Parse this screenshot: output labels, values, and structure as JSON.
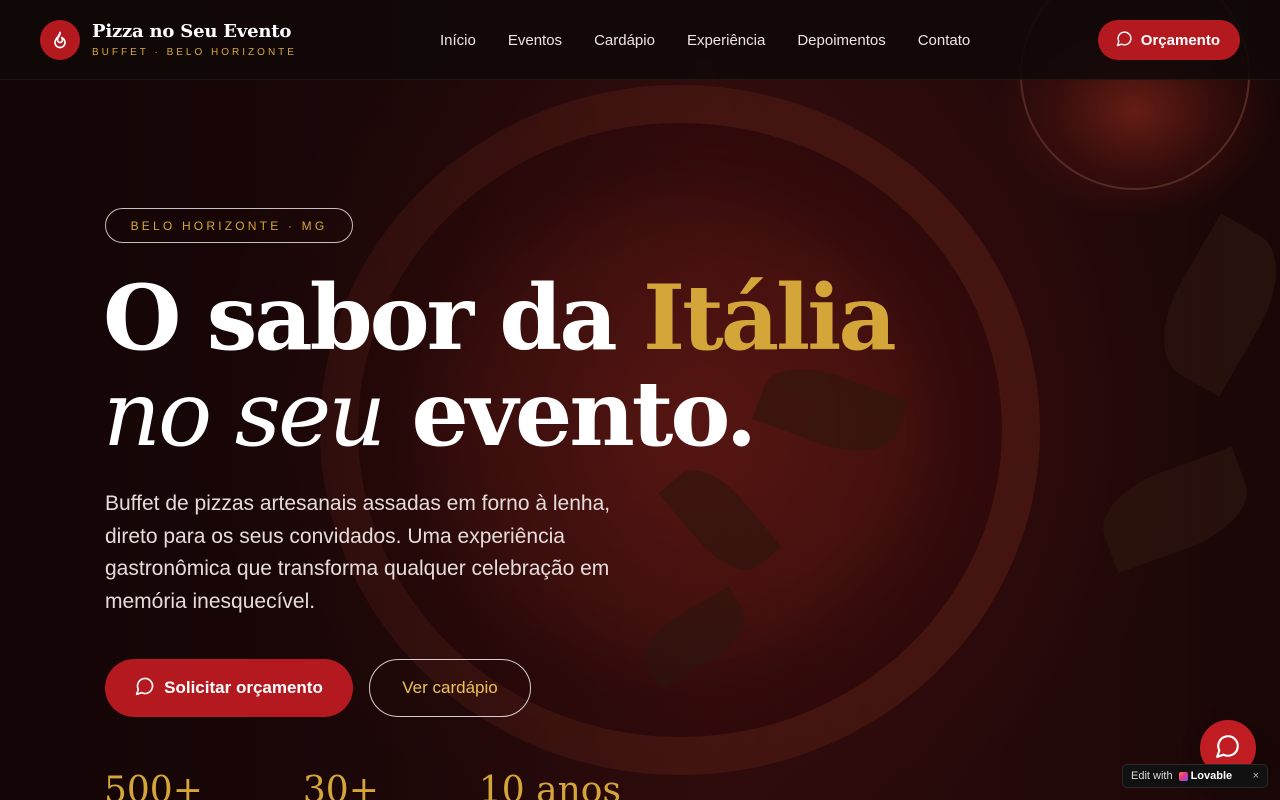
{
  "header": {
    "logo_title": "Pizza no Seu Evento",
    "logo_subtitle": "BUFFET · BELO HORIZONTE",
    "nav": [
      "Início",
      "Eventos",
      "Cardápio",
      "Experiência",
      "Depoimentos",
      "Contato"
    ],
    "cta_label": "Orçamento"
  },
  "hero": {
    "location": "BELO HORIZONTE · MG",
    "headline_line1_a": "O sabor da ",
    "headline_line1_b": "Itália",
    "headline_line2_a": "no seu",
    "headline_line2_b": " evento.",
    "lead": "Buffet de pizzas artesanais assadas em forno à lenha, direto para os seus convidados. Uma experiência gastronômica que transforma qualquer celebração em memória inesquecível.",
    "primary_button": "Solicitar orçamento",
    "secondary_button": "Ver cardápio",
    "stats": [
      "500+",
      "30+",
      "10 anos"
    ]
  },
  "badge": {
    "edit_with": "Edit with",
    "brand": "Lovable",
    "close": "×"
  },
  "colors": {
    "accent_red": "#b3191e",
    "accent_gold": "#d4a63a"
  },
  "icons": {
    "logo": "flame-icon",
    "cta": "chat-bubble-icon",
    "fab": "chat-bubble-icon"
  }
}
